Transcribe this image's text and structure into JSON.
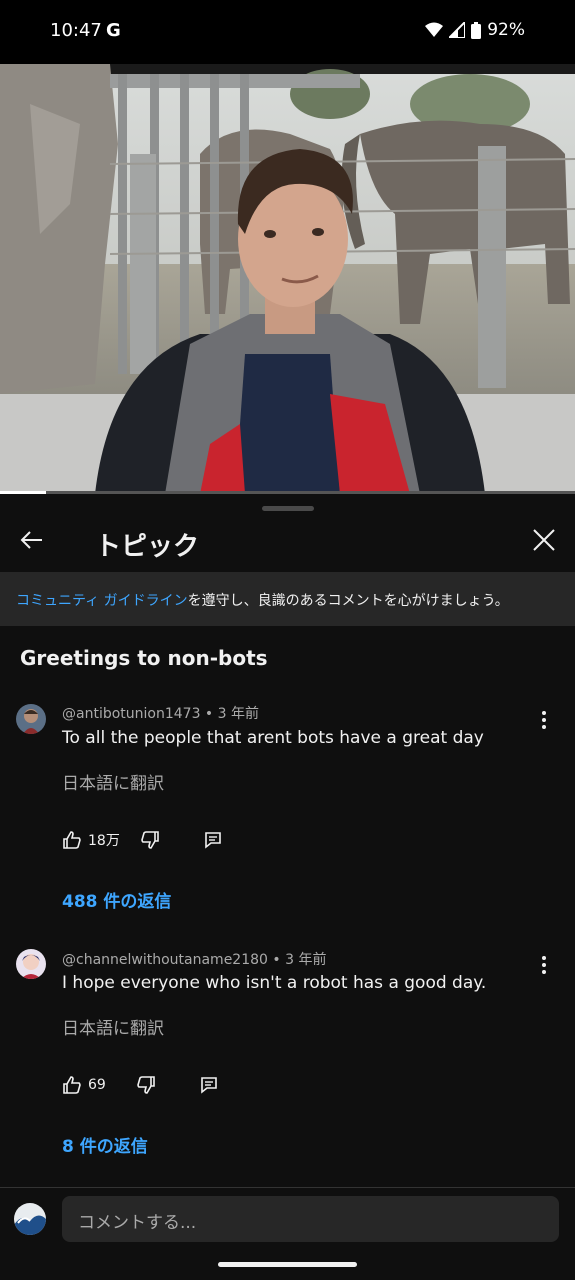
{
  "status_bar": {
    "time": "10:47",
    "g_label": "G",
    "battery": "92%"
  },
  "video": {
    "progress_fraction": 0.08
  },
  "panel": {
    "title": "トピック",
    "guideline_link": "コミュニティ ガイドライン",
    "guideline_rest": "を遵守し、良識のあるコメントを心がけましょう。",
    "section_title": "Greetings to non-bots"
  },
  "comments": [
    {
      "meta": "@antibotunion1473 • 3 年前",
      "text": "To all the people that arent bots have a great day",
      "translate": "日本語に翻訳",
      "likes": "18万",
      "replies": "488 件の返信"
    },
    {
      "meta": "@channelwithoutaname2180 • 3 年前",
      "text": "I hope everyone who isn't a robot has a good day.",
      "translate": "日本語に翻訳",
      "likes": "69",
      "replies": "8 件の返信"
    }
  ],
  "composer": {
    "placeholder": "コメントする..."
  },
  "icons": [
    "back-arrow-icon",
    "close-icon",
    "thumb-up-icon",
    "thumb-down-icon",
    "reply-icon",
    "more-vert-icon",
    "wifi-icon",
    "signal-icon",
    "battery-icon"
  ],
  "colors": {
    "accent": "#3ea6ff",
    "background": "#0f0f0f",
    "surface": "#272727"
  }
}
